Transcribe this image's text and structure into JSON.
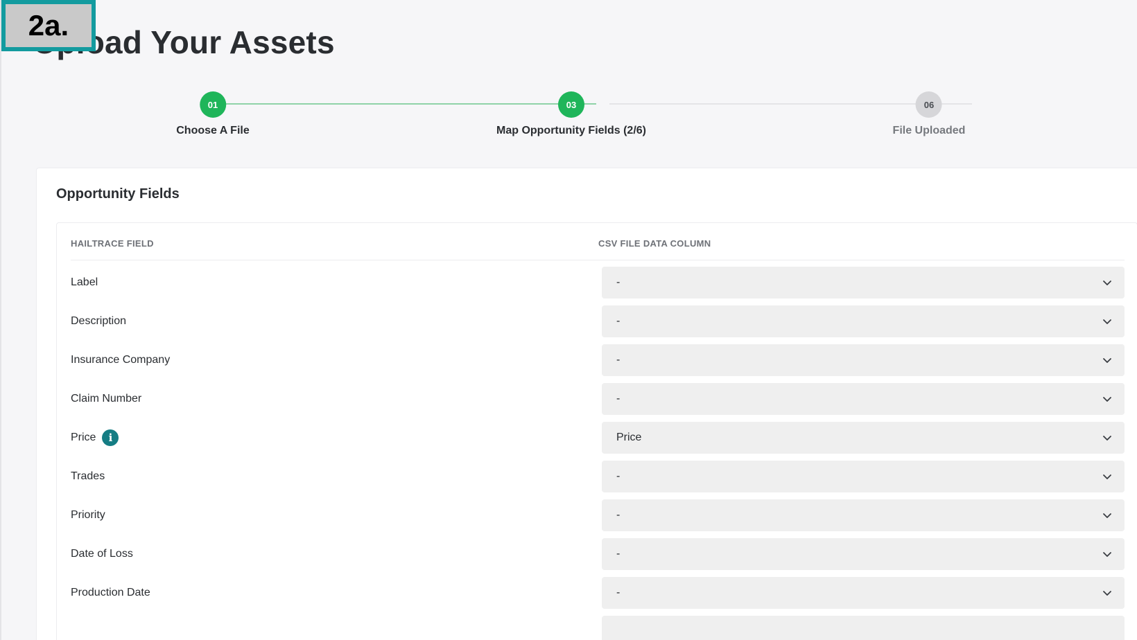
{
  "badge": {
    "text": "2a."
  },
  "page": {
    "title": "Upload Your Assets"
  },
  "stepper": {
    "steps": [
      {
        "number": "01",
        "label": "Choose A File",
        "state": "complete"
      },
      {
        "number": "03",
        "label": "Map Opportunity Fields (2/6)",
        "state": "current"
      },
      {
        "number": "06",
        "label": "File Uploaded",
        "state": "upcoming"
      }
    ]
  },
  "card": {
    "title": "Opportunity Fields",
    "columns": [
      "HAILTRACE FIELD",
      "CSV FILE DATA COLUMN"
    ],
    "rows": [
      {
        "field": "Label",
        "value": "-"
      },
      {
        "field": "Description",
        "value": "-"
      },
      {
        "field": "Insurance Company",
        "value": "-"
      },
      {
        "field": "Claim Number",
        "value": "-"
      },
      {
        "field": "Price",
        "value": "Price",
        "info_icon": "info-icon"
      },
      {
        "field": "Trades",
        "value": "-"
      },
      {
        "field": "Priority",
        "value": "-"
      },
      {
        "field": "Date of Loss",
        "value": "-"
      },
      {
        "field": "Production Date",
        "value": "-"
      }
    ]
  },
  "colors": {
    "accent_green": "#1fb55a",
    "badge_border": "#139b9f",
    "info_teal": "#157d84"
  }
}
